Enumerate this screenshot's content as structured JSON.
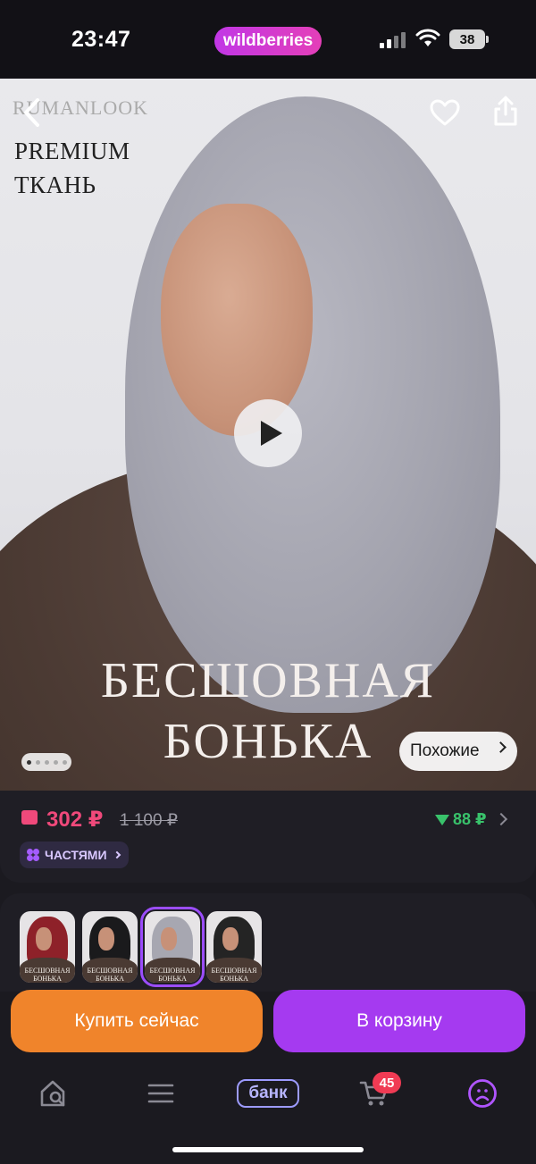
{
  "status_bar": {
    "time": "23:47",
    "brand": "wildberries",
    "battery": "38"
  },
  "product_photo": {
    "logo_text": "RUMANLOOK",
    "premium_text": "PREMIUM\nТКАНЬ",
    "headline": "БЕСШОВНАЯ\nБОНЬКА",
    "similar_label": "Похожие",
    "gallery_dots": 5,
    "gallery_active_index": 0
  },
  "price": {
    "current": "302 ₽",
    "old": "1 100 ₽",
    "points": "88 ₽",
    "installments_label": "ЧАСТЯМИ"
  },
  "variants": [
    {
      "color": "#8e2129",
      "caption": "БЕСШОВНАЯ\nБОНЬКА"
    },
    {
      "color": "#1a1a1c",
      "caption": "БЕСШОВНАЯ\nБОНЬКА"
    },
    {
      "color": "#a7a7b1",
      "caption": "БЕСШОВНАЯ\nБОНЬКА",
      "selected": true
    },
    {
      "color": "#242424",
      "caption": "БЕСШОВНАЯ\nБОНЬКА"
    }
  ],
  "actions": {
    "buy_now": "Купить сейчас",
    "add_to_cart": "В корзину"
  },
  "tabbar": {
    "items": [
      "home-search",
      "catalog",
      "bank",
      "cart",
      "profile"
    ],
    "bank_label": "банк",
    "cart_badge": "45"
  },
  "colors": {
    "accent_purple": "#a53af0",
    "buy_orange": "#f0842b",
    "price_pink": "#f0497b",
    "points_green": "#39c26b",
    "background": "#1b1a20"
  }
}
